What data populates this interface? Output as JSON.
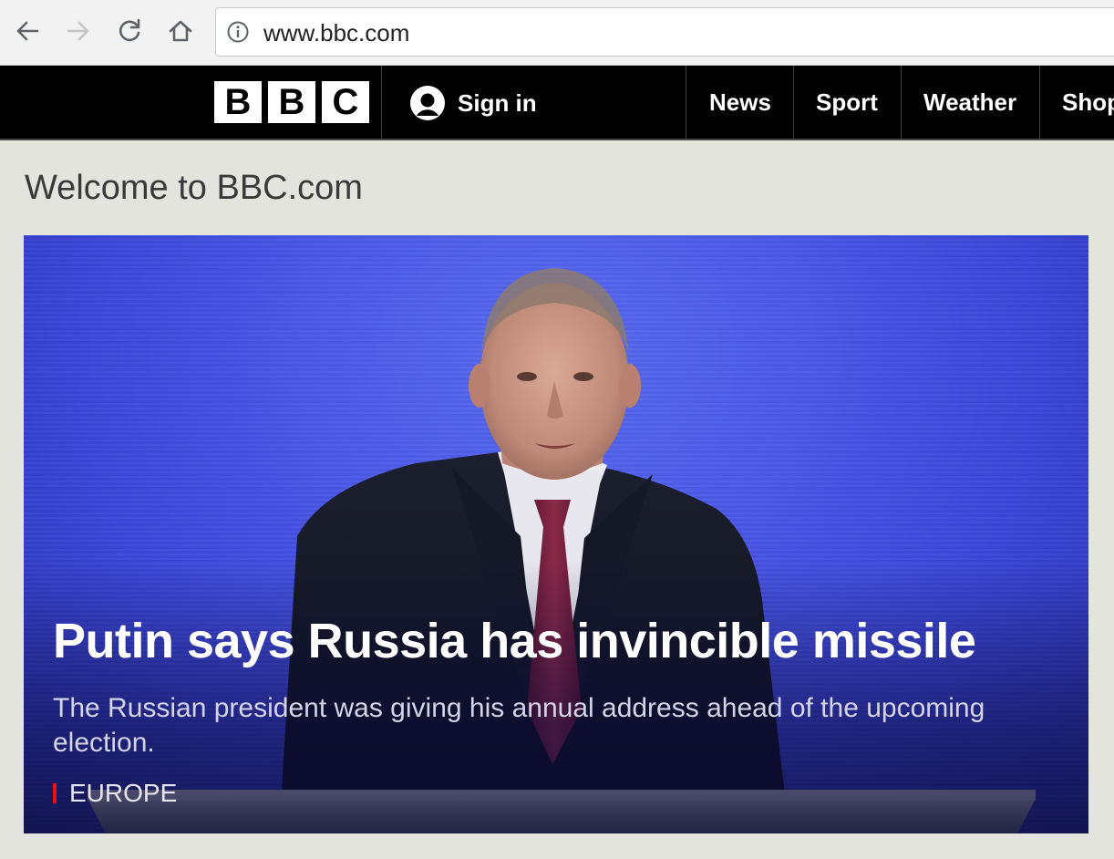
{
  "browser": {
    "url": "www.bbc.com"
  },
  "masthead": {
    "logo_letters": [
      "B",
      "B",
      "C"
    ],
    "sign_in_label": "Sign in",
    "nav": [
      "News",
      "Sport",
      "Weather",
      "Shop"
    ]
  },
  "page": {
    "welcome": "Welcome to BBC.com"
  },
  "hero": {
    "headline": "Putin says Russia has invincible missile",
    "summary": "The Russian president was giving his annual address ahead of the upcoming election.",
    "section": "EUROPE",
    "section_color": "#ee1111"
  },
  "icons": {
    "back": "back-arrow-icon",
    "forward": "forward-arrow-icon",
    "reload": "reload-icon",
    "home": "home-icon",
    "info": "info-icon",
    "user": "user-icon"
  }
}
